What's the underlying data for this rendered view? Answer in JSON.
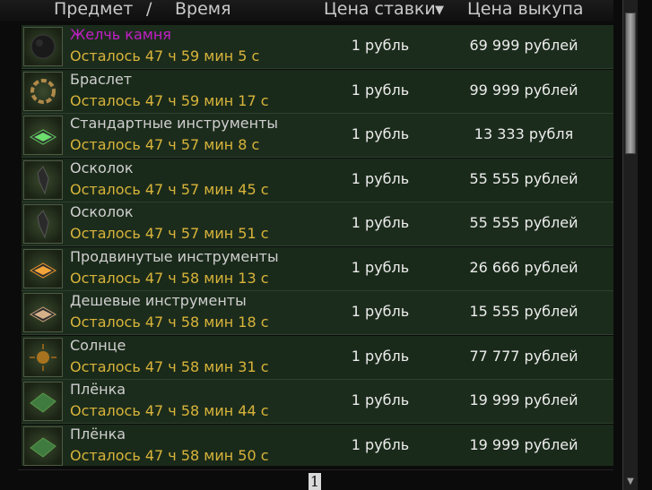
{
  "header": {
    "item_label": "Предмет",
    "separator": "/",
    "time_label": "Время",
    "bid_label": "Цена ставки",
    "sort_arrow": "▼",
    "buyout_label": "Цена выкупа"
  },
  "rows": [
    {
      "icon": "dark-stone-icon",
      "name": "Желчь камня",
      "rarity_color": "#c21fc7",
      "time": "Осталось 47 ч 59 мин 5 с",
      "bid": "1 рубль",
      "buyout": "69 999 рублей"
    },
    {
      "icon": "bracelet-icon",
      "name": "Браслет",
      "time": "Осталось 47 ч 59 мин 17 с",
      "bid": "1 рубль",
      "buyout": "99 999 рублей"
    },
    {
      "icon": "toolbox-green-icon",
      "name": "Стандартные инструменты",
      "time": "Осталось 47 ч 57 мин 8 с",
      "bid": "1 рубль",
      "buyout": "13 333 рубля"
    },
    {
      "icon": "shard-icon",
      "name": "Осколок",
      "time": "Осталось 47 ч 57 мин 45 с",
      "bid": "1 рубль",
      "buyout": "55 555 рублей"
    },
    {
      "icon": "shard-icon",
      "name": "Осколок",
      "time": "Осталось 47 ч 57 мин 51 с",
      "bid": "1 рубль",
      "buyout": "55 555 рублей"
    },
    {
      "icon": "toolbox-orange-icon",
      "name": "Продвинутые инструменты",
      "time": "Осталось 47 ч 58 мин 13 с",
      "bid": "1 рубль",
      "buyout": "26 666 рублей"
    },
    {
      "icon": "toolbox-tan-icon",
      "name": "Дешевые инструменты",
      "time": "Осталось 47 ч 58 мин 18 с",
      "bid": "1 рубль",
      "buyout": "15 555 рублей"
    },
    {
      "icon": "sun-icon",
      "name": "Солнце",
      "time": "Осталось 47 ч 58 мин 31 с",
      "bid": "1 рубль",
      "buyout": "77 777 рублей"
    },
    {
      "icon": "film-icon",
      "name": "Плёнка",
      "time": "Осталось 47 ч 58 мин 44 с",
      "bid": "1 рубль",
      "buyout": "19 999 рублей"
    },
    {
      "icon": "film-icon",
      "name": "Плёнка",
      "time": "Осталось 47 ч 58 мин 50 с",
      "bid": "1 рубль",
      "buyout": "19 999 рублей"
    }
  ],
  "pagination": {
    "current_page": "1"
  },
  "colors": {
    "item_name": "#cfcfcf",
    "rare_name": "#c21fc7",
    "time_left": "#d8b43a",
    "row_bg": "#1a2a1a"
  }
}
